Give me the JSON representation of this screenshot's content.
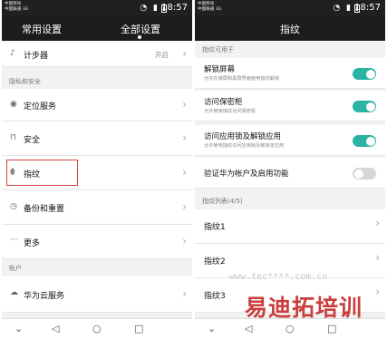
{
  "status_bar": {
    "carrier1": "中国移动",
    "carrier2": "中国联通 3G",
    "time": "18:57"
  },
  "left_screen": {
    "tabs": [
      "常用设置",
      "全部设置"
    ],
    "active_tab": "全部设置",
    "rows": [
      {
        "label": "计步器",
        "value": "开启",
        "icon": "footsteps-icon"
      },
      {
        "label": "定位服务",
        "icon": "location-pin-icon"
      },
      {
        "label": "安全",
        "icon": "lock-icon"
      },
      {
        "label": "指纹",
        "icon": "fingerprint-icon",
        "highlighted": true
      },
      {
        "label": "备份和重置",
        "icon": "backup-icon"
      },
      {
        "label": "更多",
        "icon": "more-dots-icon"
      },
      {
        "label": "华为云服务",
        "icon": "cloud-icon"
      }
    ],
    "sections": [
      "隐私和安全",
      "帐户"
    ]
  },
  "right_screen": {
    "title": "指纹",
    "section_usage": "指纹可用于",
    "toggles": [
      {
        "title": "解锁屏幕",
        "subtitle": "允许在锁屏和黑屏界面使用指纹解锁",
        "on": true
      },
      {
        "title": "访问保密柜",
        "subtitle": "允许使用指纹访问保密柜",
        "on": true
      },
      {
        "title": "访问应用锁及解锁应用",
        "subtitle": "允许使用指纹访问应用锁及被锁定应用",
        "on": true
      },
      {
        "title": "验证华为帐户及启用功能",
        "subtitle": "",
        "on": false
      }
    ],
    "list_header": "指纹列表(4/5)",
    "fingerprints": [
      "指纹1",
      "指纹2",
      "指纹3"
    ]
  },
  "nav_icons": [
    "chevron-down-icon",
    "back-triangle-icon",
    "home-circle-icon",
    "recents-square-icon"
  ],
  "watermark": {
    "url": "www.tec****.com.cn",
    "logo": "易迪拓培训"
  },
  "colors": {
    "toggle_on": "#2bb3a3",
    "highlight": "#d9403f",
    "topbar": "#1c1c1c"
  }
}
